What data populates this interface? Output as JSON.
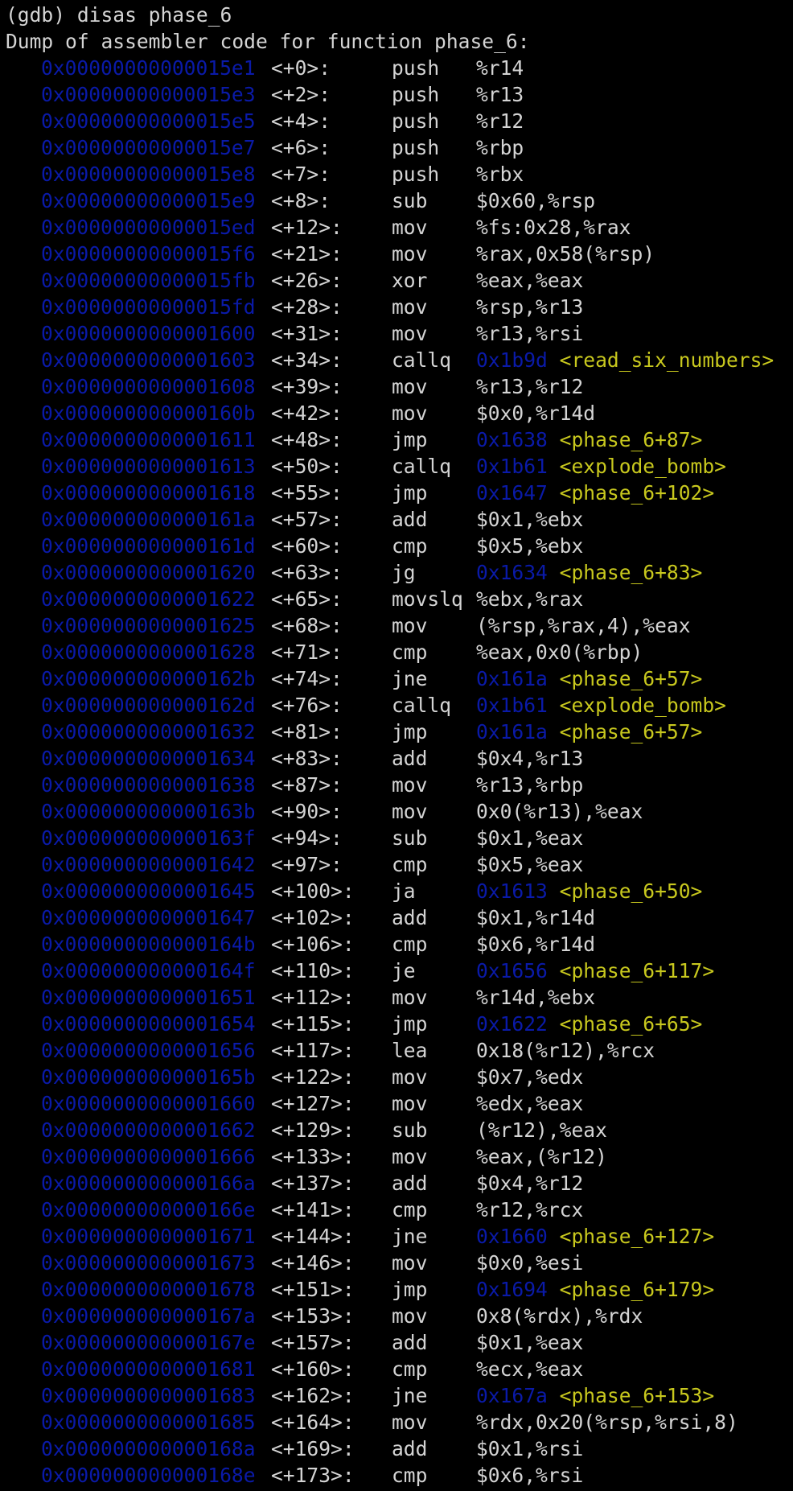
{
  "terminal": {
    "prompt_line": "(gdb) disas phase_6",
    "dump_header": "Dump of assembler code for function phase_6:",
    "colors": {
      "background": "#000000",
      "text": "#d4d4d4",
      "address": "#0a1aa8",
      "symbol": "#c8c81e"
    },
    "instructions": [
      {
        "addr": "0x00000000000015e1",
        "offset": "<+0>:",
        "mnemonic": "push",
        "operands": "%r14"
      },
      {
        "addr": "0x00000000000015e3",
        "offset": "<+2>:",
        "mnemonic": "push",
        "operands": "%r13"
      },
      {
        "addr": "0x00000000000015e5",
        "offset": "<+4>:",
        "mnemonic": "push",
        "operands": "%r12"
      },
      {
        "addr": "0x00000000000015e7",
        "offset": "<+6>:",
        "mnemonic": "push",
        "operands": "%rbp"
      },
      {
        "addr": "0x00000000000015e8",
        "offset": "<+7>:",
        "mnemonic": "push",
        "operands": "%rbx"
      },
      {
        "addr": "0x00000000000015e9",
        "offset": "<+8>:",
        "mnemonic": "sub",
        "operands": "$0x60,%rsp"
      },
      {
        "addr": "0x00000000000015ed",
        "offset": "<+12>:",
        "mnemonic": "mov",
        "operands": "%fs:0x28,%rax"
      },
      {
        "addr": "0x00000000000015f6",
        "offset": "<+21>:",
        "mnemonic": "mov",
        "operands": "%rax,0x58(%rsp)"
      },
      {
        "addr": "0x00000000000015fb",
        "offset": "<+26>:",
        "mnemonic": "xor",
        "operands": "%eax,%eax"
      },
      {
        "addr": "0x00000000000015fd",
        "offset": "<+28>:",
        "mnemonic": "mov",
        "operands": "%rsp,%r13"
      },
      {
        "addr": "0x0000000000001600",
        "offset": "<+31>:",
        "mnemonic": "mov",
        "operands": "%r13,%rsi"
      },
      {
        "addr": "0x0000000000001603",
        "offset": "<+34>:",
        "mnemonic": "callq",
        "operands": "",
        "target_addr": "0x1b9d",
        "target_sym": "<read_six_numbers>"
      },
      {
        "addr": "0x0000000000001608",
        "offset": "<+39>:",
        "mnemonic": "mov",
        "operands": "%r13,%r12"
      },
      {
        "addr": "0x000000000000160b",
        "offset": "<+42>:",
        "mnemonic": "mov",
        "operands": "$0x0,%r14d"
      },
      {
        "addr": "0x0000000000001611",
        "offset": "<+48>:",
        "mnemonic": "jmp",
        "operands": "",
        "target_addr": "0x1638",
        "target_sym": "<phase_6+87>"
      },
      {
        "addr": "0x0000000000001613",
        "offset": "<+50>:",
        "mnemonic": "callq",
        "operands": "",
        "target_addr": "0x1b61",
        "target_sym": "<explode_bomb>"
      },
      {
        "addr": "0x0000000000001618",
        "offset": "<+55>:",
        "mnemonic": "jmp",
        "operands": "",
        "target_addr": "0x1647",
        "target_sym": "<phase_6+102>"
      },
      {
        "addr": "0x000000000000161a",
        "offset": "<+57>:",
        "mnemonic": "add",
        "operands": "$0x1,%ebx"
      },
      {
        "addr": "0x000000000000161d",
        "offset": "<+60>:",
        "mnemonic": "cmp",
        "operands": "$0x5,%ebx"
      },
      {
        "addr": "0x0000000000001620",
        "offset": "<+63>:",
        "mnemonic": "jg",
        "operands": "",
        "target_addr": "0x1634",
        "target_sym": "<phase_6+83>"
      },
      {
        "addr": "0x0000000000001622",
        "offset": "<+65>:",
        "mnemonic": "movslq",
        "operands": "%ebx,%rax"
      },
      {
        "addr": "0x0000000000001625",
        "offset": "<+68>:",
        "mnemonic": "mov",
        "operands": "(%rsp,%rax,4),%eax"
      },
      {
        "addr": "0x0000000000001628",
        "offset": "<+71>:",
        "mnemonic": "cmp",
        "operands": "%eax,0x0(%rbp)"
      },
      {
        "addr": "0x000000000000162b",
        "offset": "<+74>:",
        "mnemonic": "jne",
        "operands": "",
        "target_addr": "0x161a",
        "target_sym": "<phase_6+57>"
      },
      {
        "addr": "0x000000000000162d",
        "offset": "<+76>:",
        "mnemonic": "callq",
        "operands": "",
        "target_addr": "0x1b61",
        "target_sym": "<explode_bomb>"
      },
      {
        "addr": "0x0000000000001632",
        "offset": "<+81>:",
        "mnemonic": "jmp",
        "operands": "",
        "target_addr": "0x161a",
        "target_sym": "<phase_6+57>"
      },
      {
        "addr": "0x0000000000001634",
        "offset": "<+83>:",
        "mnemonic": "add",
        "operands": "$0x4,%r13"
      },
      {
        "addr": "0x0000000000001638",
        "offset": "<+87>:",
        "mnemonic": "mov",
        "operands": "%r13,%rbp"
      },
      {
        "addr": "0x000000000000163b",
        "offset": "<+90>:",
        "mnemonic": "mov",
        "operands": "0x0(%r13),%eax"
      },
      {
        "addr": "0x000000000000163f",
        "offset": "<+94>:",
        "mnemonic": "sub",
        "operands": "$0x1,%eax"
      },
      {
        "addr": "0x0000000000001642",
        "offset": "<+97>:",
        "mnemonic": "cmp",
        "operands": "$0x5,%eax"
      },
      {
        "addr": "0x0000000000001645",
        "offset": "<+100>:",
        "mnemonic": "ja",
        "operands": "",
        "target_addr": "0x1613",
        "target_sym": "<phase_6+50>"
      },
      {
        "addr": "0x0000000000001647",
        "offset": "<+102>:",
        "mnemonic": "add",
        "operands": "$0x1,%r14d"
      },
      {
        "addr": "0x000000000000164b",
        "offset": "<+106>:",
        "mnemonic": "cmp",
        "operands": "$0x6,%r14d"
      },
      {
        "addr": "0x000000000000164f",
        "offset": "<+110>:",
        "mnemonic": "je",
        "operands": "",
        "target_addr": "0x1656",
        "target_sym": "<phase_6+117>"
      },
      {
        "addr": "0x0000000000001651",
        "offset": "<+112>:",
        "mnemonic": "mov",
        "operands": "%r14d,%ebx"
      },
      {
        "addr": "0x0000000000001654",
        "offset": "<+115>:",
        "mnemonic": "jmp",
        "operands": "",
        "target_addr": "0x1622",
        "target_sym": "<phase_6+65>"
      },
      {
        "addr": "0x0000000000001656",
        "offset": "<+117>:",
        "mnemonic": "lea",
        "operands": "0x18(%r12),%rcx"
      },
      {
        "addr": "0x000000000000165b",
        "offset": "<+122>:",
        "mnemonic": "mov",
        "operands": "$0x7,%edx"
      },
      {
        "addr": "0x0000000000001660",
        "offset": "<+127>:",
        "mnemonic": "mov",
        "operands": "%edx,%eax"
      },
      {
        "addr": "0x0000000000001662",
        "offset": "<+129>:",
        "mnemonic": "sub",
        "operands": "(%r12),%eax"
      },
      {
        "addr": "0x0000000000001666",
        "offset": "<+133>:",
        "mnemonic": "mov",
        "operands": "%eax,(%r12)"
      },
      {
        "addr": "0x000000000000166a",
        "offset": "<+137>:",
        "mnemonic": "add",
        "operands": "$0x4,%r12"
      },
      {
        "addr": "0x000000000000166e",
        "offset": "<+141>:",
        "mnemonic": "cmp",
        "operands": "%r12,%rcx"
      },
      {
        "addr": "0x0000000000001671",
        "offset": "<+144>:",
        "mnemonic": "jne",
        "operands": "",
        "target_addr": "0x1660",
        "target_sym": "<phase_6+127>"
      },
      {
        "addr": "0x0000000000001673",
        "offset": "<+146>:",
        "mnemonic": "mov",
        "operands": "$0x0,%esi"
      },
      {
        "addr": "0x0000000000001678",
        "offset": "<+151>:",
        "mnemonic": "jmp",
        "operands": "",
        "target_addr": "0x1694",
        "target_sym": "<phase_6+179>"
      },
      {
        "addr": "0x000000000000167a",
        "offset": "<+153>:",
        "mnemonic": "mov",
        "operands": "0x8(%rdx),%rdx"
      },
      {
        "addr": "0x000000000000167e",
        "offset": "<+157>:",
        "mnemonic": "add",
        "operands": "$0x1,%eax"
      },
      {
        "addr": "0x0000000000001681",
        "offset": "<+160>:",
        "mnemonic": "cmp",
        "operands": "%ecx,%eax"
      },
      {
        "addr": "0x0000000000001683",
        "offset": "<+162>:",
        "mnemonic": "jne",
        "operands": "",
        "target_addr": "0x167a",
        "target_sym": "<phase_6+153>"
      },
      {
        "addr": "0x0000000000001685",
        "offset": "<+164>:",
        "mnemonic": "mov",
        "operands": "%rdx,0x20(%rsp,%rsi,8)"
      },
      {
        "addr": "0x000000000000168a",
        "offset": "<+169>:",
        "mnemonic": "add",
        "operands": "$0x1,%rsi"
      },
      {
        "addr": "0x000000000000168e",
        "offset": "<+173>:",
        "mnemonic": "cmp",
        "operands": "$0x6,%rsi"
      }
    ]
  }
}
